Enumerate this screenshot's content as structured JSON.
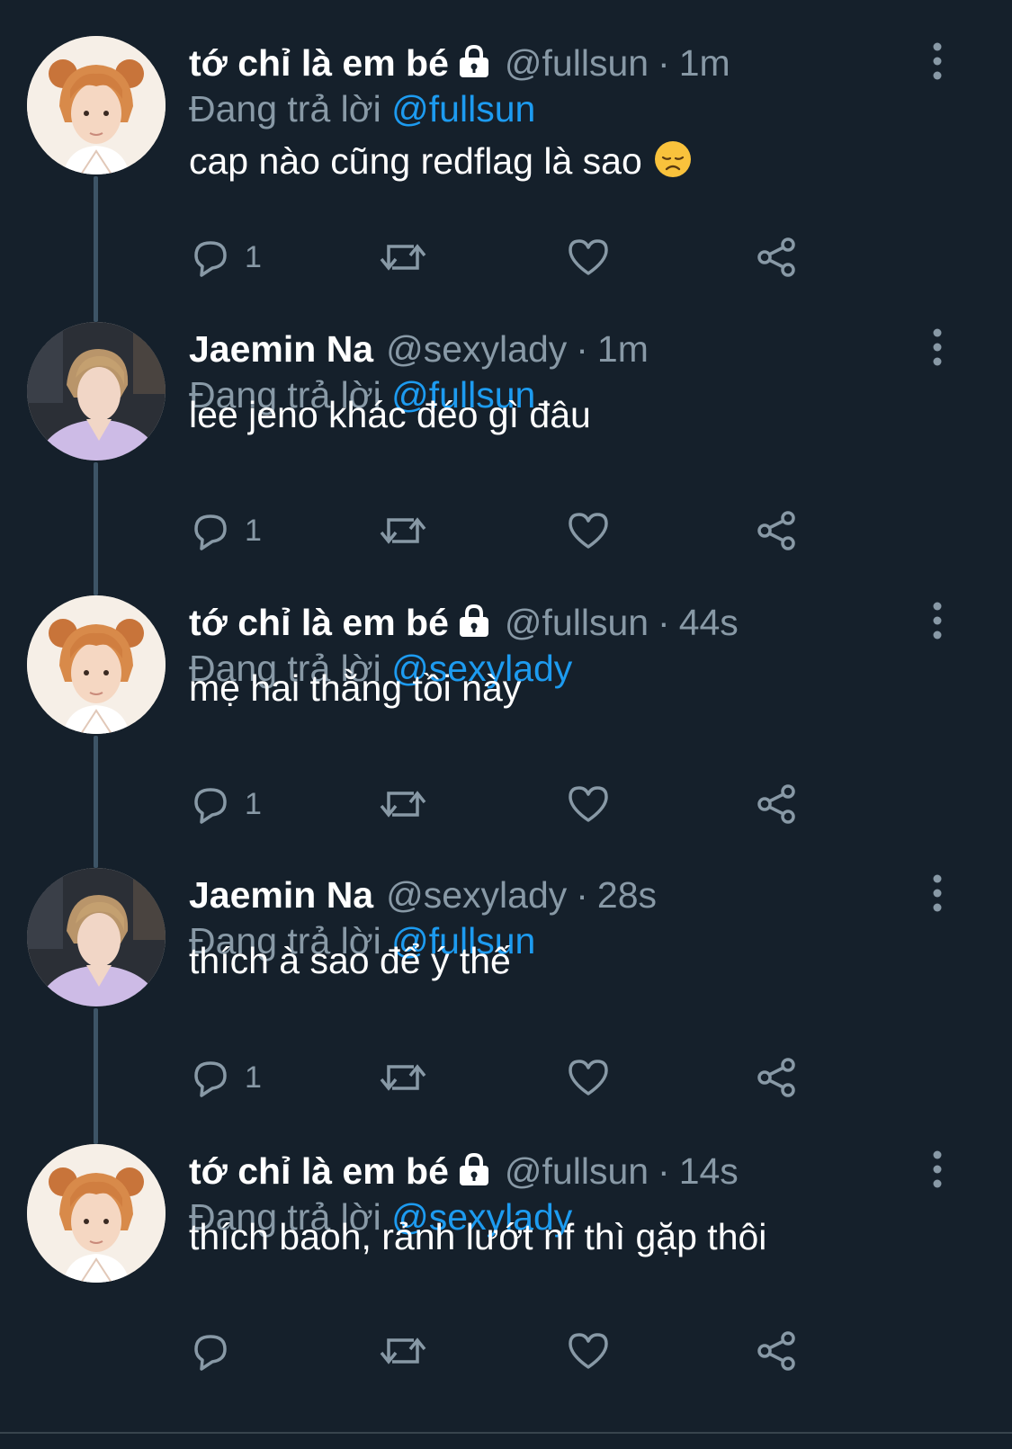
{
  "tweets": [
    {
      "name": "tớ chỉ là em bé",
      "locked": true,
      "handle": "@fullsun",
      "separator": "·",
      "time": "1m",
      "reply_prefix": "Đang trả lời",
      "reply_to": "@fullsun",
      "text": "cap nào cũng redflag là sao",
      "emoji": "disappointed-face",
      "reply_count": "1",
      "avatar": "orange-hair-bear-ears"
    },
    {
      "name": "Jaemin Na",
      "locked": false,
      "handle": "@sexylady",
      "separator": "·",
      "time": "1m",
      "reply_prefix": "Đang trả lời",
      "reply_to": "@fullsun",
      "text": "lee jeno khác đéo gì đâu",
      "reply_count": "1",
      "avatar": "purple-shirt"
    },
    {
      "name": "tớ chỉ là em bé",
      "locked": true,
      "handle": "@fullsun",
      "separator": "·",
      "time": "44s",
      "reply_prefix": "Đang trả lời",
      "reply_to": "@sexylady",
      "text": "mẹ hai thằng tồi này",
      "reply_count": "1",
      "avatar": "orange-hair-bear-ears"
    },
    {
      "name": "Jaemin Na",
      "locked": false,
      "handle": "@sexylady",
      "separator": "·",
      "time": "28s",
      "reply_prefix": "Đang trả lời",
      "reply_to": "@fullsun",
      "text": "thích à sao để ý thế",
      "reply_count": "1",
      "avatar": "purple-shirt"
    },
    {
      "name": "tớ chỉ là em bé",
      "locked": true,
      "handle": "@fullsun",
      "separator": "·",
      "time": "14s",
      "reply_prefix": "Đang trả lời",
      "reply_to": "@sexylady",
      "text": "thích baoh, rảnh lướt nf thì gặp thôi",
      "reply_count": "",
      "avatar": "orange-hair-bear-ears"
    }
  ],
  "icons": {
    "reply": "reply-icon",
    "retweet": "retweet-icon",
    "like": "like-icon",
    "share": "share-icon",
    "more": "more-vertical-icon",
    "lock": "lock-icon"
  },
  "colors": {
    "background": "#15202b",
    "text": "#ffffff",
    "secondary": "#8899a6",
    "mention": "#1d9bf0",
    "thread_line": "#3d5466"
  }
}
